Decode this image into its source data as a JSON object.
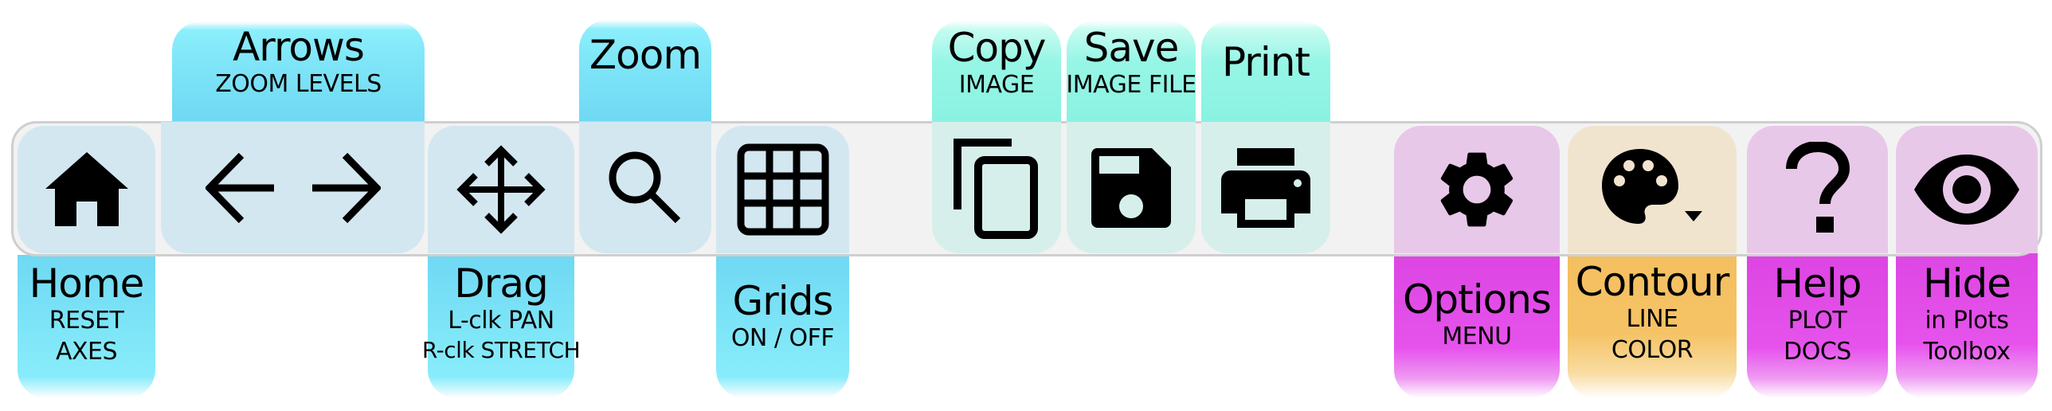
{
  "toolbar": {
    "buttons": [
      {
        "id": "home",
        "icon": "home-icon",
        "label": "Home",
        "sub": [
          "RESET",
          "AXES"
        ],
        "label_position": "bottom",
        "color": "#6fd8f3"
      },
      {
        "id": "arrows",
        "icon": "arrow-left-right-icon",
        "label": "Arrows",
        "sub": [
          "ZOOM LEVELS"
        ],
        "label_position": "top",
        "color": "#7fe6f8"
      },
      {
        "id": "drag",
        "icon": "move-icon",
        "label": "Drag",
        "sub": [
          "L-clk PAN",
          "R-clk STRETCH"
        ],
        "label_position": "bottom",
        "color": "#6fd8f3"
      },
      {
        "id": "zoom",
        "icon": "magnifier-icon",
        "label": "Zoom",
        "sub": [],
        "label_position": "top",
        "color": "#7fe6f8"
      },
      {
        "id": "grids",
        "icon": "grid-icon",
        "label": "Grids",
        "sub": [
          "ON / OFF"
        ],
        "label_position": "bottom",
        "color": "#6fd8f3"
      },
      {
        "id": "copy",
        "icon": "copy-icon",
        "label": "Copy",
        "sub": [
          "IMAGE"
        ],
        "label_position": "top",
        "color": "#8af2e1"
      },
      {
        "id": "save",
        "icon": "floppy-disk-icon",
        "label": "Save",
        "sub": [
          "IMAGE FILE"
        ],
        "label_position": "top",
        "color": "#8af2e1"
      },
      {
        "id": "print",
        "icon": "printer-icon",
        "label": "Print",
        "sub": [],
        "label_position": "top",
        "color": "#8af2e1"
      },
      {
        "id": "options",
        "icon": "gear-icon",
        "label": "Options",
        "sub": [
          "MENU"
        ],
        "label_position": "bottom",
        "color": "#dc45e2"
      },
      {
        "id": "contour",
        "icon": "palette-dropdown-icon",
        "label": "Contour",
        "sub": [
          "LINE",
          "COLOR"
        ],
        "label_position": "bottom",
        "color": "#f4bf60"
      },
      {
        "id": "help",
        "icon": "question-mark-icon",
        "label": "Help",
        "sub": [
          "PLOT",
          "DOCS"
        ],
        "label_position": "bottom",
        "color": "#dc45e2"
      },
      {
        "id": "hide",
        "icon": "eye-icon",
        "label": "Hide",
        "sub": [
          "in Plots",
          "Toolbox"
        ],
        "label_position": "bottom",
        "color": "#dc45e2"
      }
    ]
  }
}
